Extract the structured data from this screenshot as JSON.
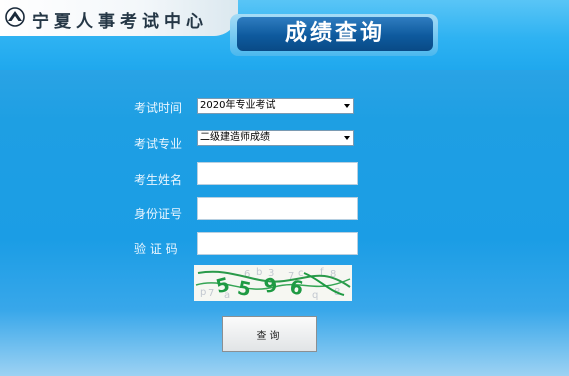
{
  "header": {
    "site_name": "宁夏人事考试中心",
    "page_title": "成绩查询"
  },
  "form": {
    "exam_time": {
      "label": "考试时间",
      "selected": "2020年专业考试"
    },
    "exam_major": {
      "label": "考试专业",
      "selected": "二级建造师成绩"
    },
    "name": {
      "label": "考生姓名",
      "value": ""
    },
    "id_number": {
      "label": "身份证号",
      "value": ""
    },
    "captcha": {
      "label": "验 证 码",
      "value": ""
    },
    "submit_label": "查询"
  },
  "colors": {
    "title_bg": "#0e5a9e",
    "page_bg": "#1b9de5",
    "captcha_green": "#1e9a43"
  }
}
